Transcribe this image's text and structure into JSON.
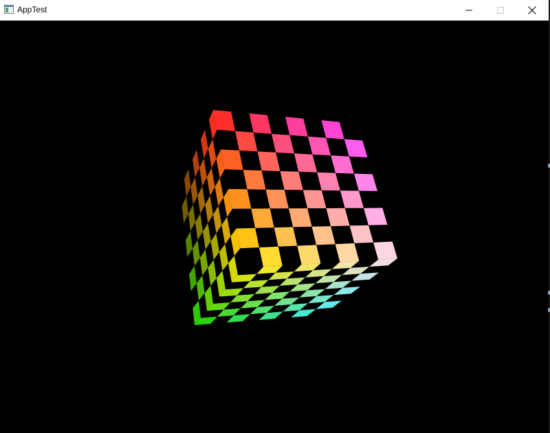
{
  "window": {
    "title": "AppTest",
    "icon": "app-window-icon",
    "controls": [
      "minimize-icon",
      "maximize-icon",
      "close-icon"
    ]
  },
  "scene": {
    "object": "checkered-cube",
    "background": "#000000",
    "accent_colors": {
      "top_left": "#ff2020",
      "top_right": "#ff40ff",
      "front_bottom_left": "#ffe800",
      "front_bottom_right": "#ffe0f0",
      "left_bottom": "#18d000",
      "bottom_right": "#40f0ff"
    }
  }
}
